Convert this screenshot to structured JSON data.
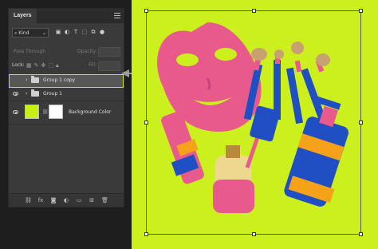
{
  "panel": {
    "tab_label": "Layers",
    "filter_kind": "Kind",
    "blend_mode": "Pass Through",
    "opacity_label": "Opacity:",
    "lock_label": "Lock:",
    "fill_label": "Fill:"
  },
  "layers": [
    {
      "name": "Group 1 copy",
      "visible": false,
      "selected": true,
      "type": "group"
    },
    {
      "name": "Group 1",
      "visible": true,
      "selected": false,
      "type": "group"
    },
    {
      "name": "Background Color",
      "visible": true,
      "selected": false,
      "type": "fill",
      "color": "#c9f015",
      "mask_color": "#ffffff"
    }
  ],
  "colors": {
    "canvas_background": "#cbf01e",
    "selection_outline": "#c8e81a",
    "panel_background": "#3a3a3a"
  },
  "icons": {
    "filter": [
      "image-filter-icon",
      "adjustment-filter-icon",
      "type-filter-icon",
      "shape-filter-icon",
      "smart-object-filter-icon",
      "filter-toggle-icon"
    ],
    "lock": [
      "lock-transparent-icon",
      "lock-image-icon",
      "lock-position-icon",
      "lock-artboard-icon",
      "lock-all-icon"
    ],
    "bottom": [
      "link-layers-icon",
      "fx-icon",
      "mask-icon",
      "adjustment-icon",
      "new-group-icon",
      "new-layer-icon",
      "delete-icon"
    ]
  },
  "bottom_labels": {
    "fx": "fx"
  }
}
